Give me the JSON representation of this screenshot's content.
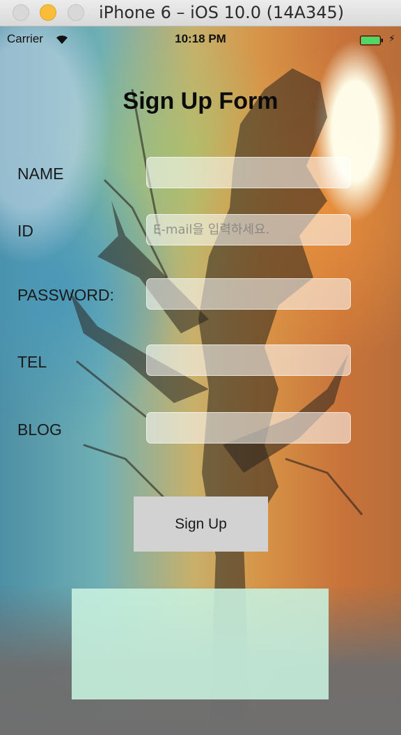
{
  "window": {
    "title": "iPhone 6 – iOS 10.0 (14A345)"
  },
  "status_bar": {
    "carrier": "Carrier",
    "time": "10:18 PM",
    "battery_color": "#4cd964"
  },
  "form": {
    "title": "Sign Up Form",
    "fields": [
      {
        "label": "NAME",
        "value": "",
        "placeholder": ""
      },
      {
        "label": "ID",
        "value": "",
        "placeholder": "E-mail을 입력하세요."
      },
      {
        "label": "PASSWORD:",
        "value": "",
        "placeholder": ""
      },
      {
        "label": "TEL",
        "value": "",
        "placeholder": ""
      },
      {
        "label": "BLOG",
        "value": "",
        "placeholder": ""
      }
    ],
    "submit_label": "Sign Up"
  },
  "colors": {
    "button_bg": "#d1d2d1",
    "result_panel_bg": "#c8f2e0"
  }
}
